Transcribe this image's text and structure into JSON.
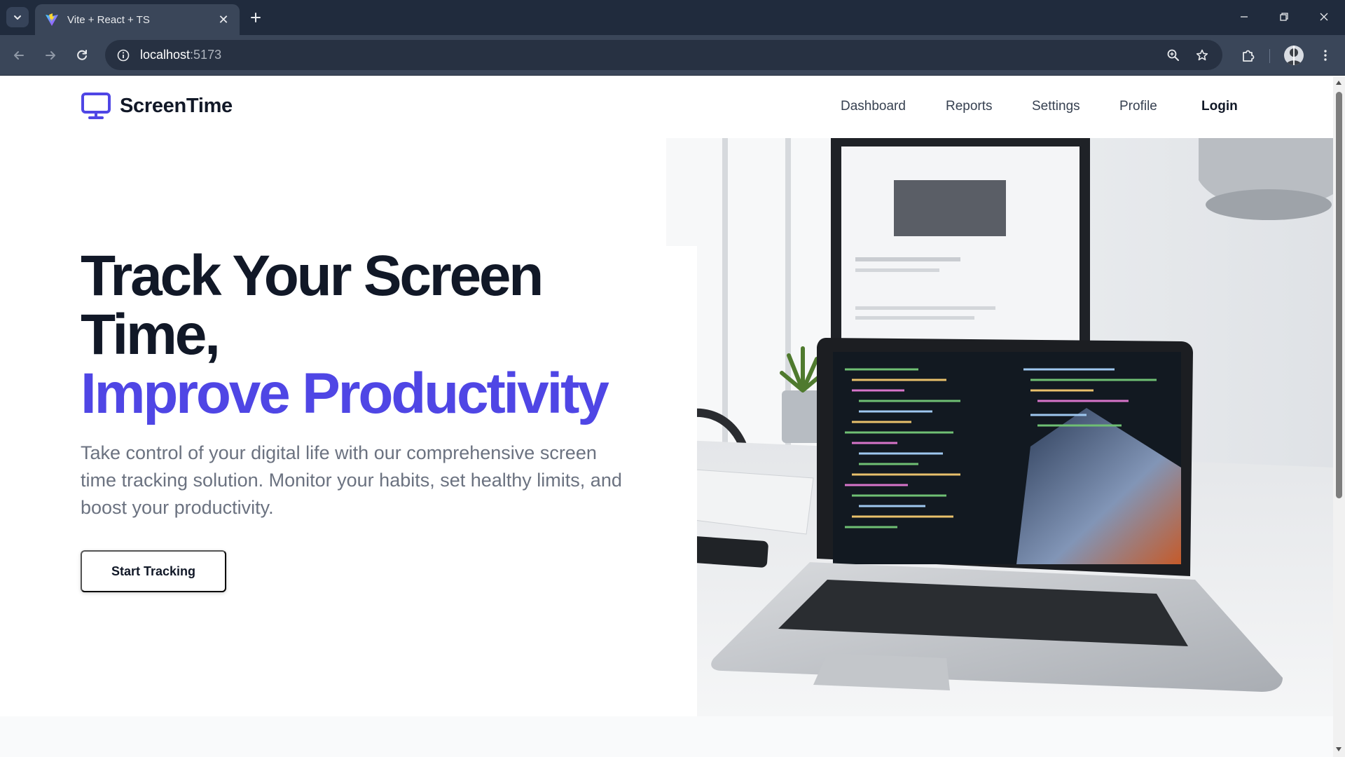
{
  "browser": {
    "tab_title": "Vite + React + TS",
    "url_host": "localhost",
    "url_port": ":5173"
  },
  "nav": {
    "brand": "ScreenTime",
    "links": [
      "Dashboard",
      "Reports",
      "Settings",
      "Profile"
    ],
    "login": "Login"
  },
  "hero": {
    "headline_line1": "Track Your Screen",
    "headline_line2": "Time,",
    "headline_accent": "Improve Productivity",
    "subtext": "Take control of your digital life with our comprehensive screen time tracking solution. Monitor your habits, set healthy limits, and boost your productivity.",
    "cta": "Start Tracking"
  },
  "colors": {
    "accent": "#4f46e5",
    "heading": "#111827",
    "body_text": "#6b7280",
    "chrome_bg": "#202b3d"
  }
}
